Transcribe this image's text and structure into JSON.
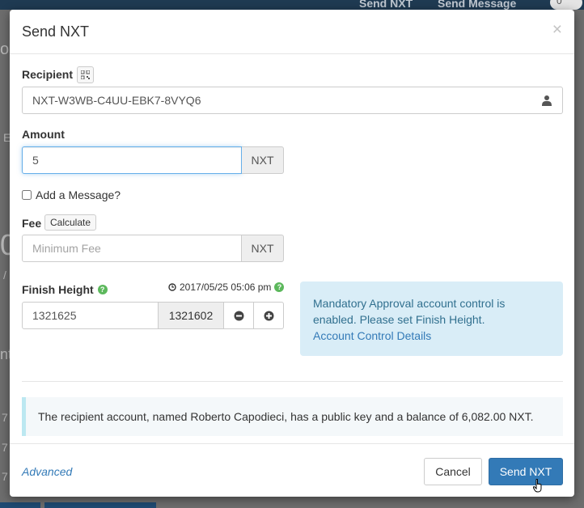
{
  "background": {
    "nav_send_nxt": "Send NXT",
    "nav_send_message": "Send Message",
    "badge": "0"
  },
  "modal": {
    "title": "Send NXT",
    "close_glyph": "×"
  },
  "recipient": {
    "label": "Recipient",
    "value": "NXT-W3WB-C4UU-EBK7-8VYQ6"
  },
  "amount": {
    "label": "Amount",
    "value": "5",
    "unit": "NXT"
  },
  "message": {
    "checkbox_label": "Add a Message?",
    "checked": false
  },
  "fee": {
    "label": "Fee",
    "calculate_label": "Calculate",
    "placeholder": "Minimum Fee",
    "unit": "NXT"
  },
  "finish_height": {
    "label": "Finish Height",
    "datetime": "2017/05/25 05:06 pm",
    "value": "1321625",
    "current_height": "1321602"
  },
  "alert": {
    "text": "Mandatory Approval account control is enabled. Please set Finish Height.",
    "link": "Account Control Details"
  },
  "callout": {
    "text": "The recipient account, named Roberto Capodieci, has a public key and a balance of 6,082.00 NXT."
  },
  "footer": {
    "advanced": "Advanced",
    "cancel": "Cancel",
    "submit": "Send NXT"
  },
  "colors": {
    "primary": "#337ab7",
    "info_bg": "#d9edf7",
    "help_green": "#5cb85c"
  }
}
